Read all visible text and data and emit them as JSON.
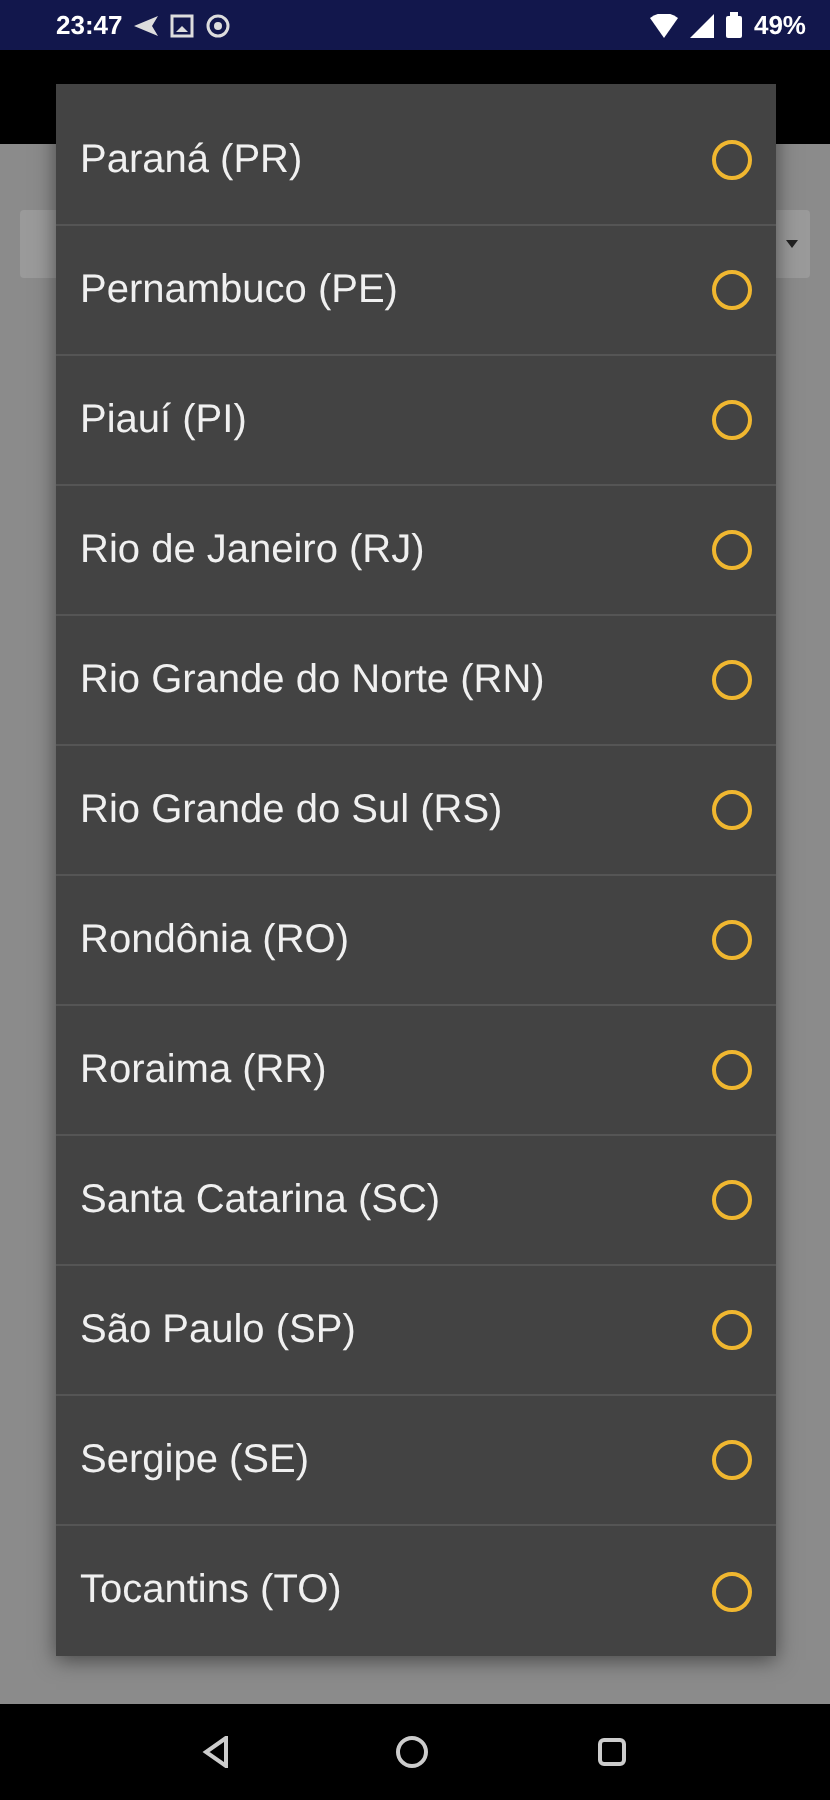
{
  "status_bar": {
    "time": "23:47",
    "battery": "49%"
  },
  "dialog": {
    "options": [
      {
        "label": "Paraná (PR)",
        "selected": false
      },
      {
        "label": "Pernambuco (PE)",
        "selected": false
      },
      {
        "label": "Piauí (PI)",
        "selected": false
      },
      {
        "label": "Rio de Janeiro (RJ)",
        "selected": false
      },
      {
        "label": "Rio Grande do Norte (RN)",
        "selected": false
      },
      {
        "label": "Rio Grande do Sul (RS)",
        "selected": false
      },
      {
        "label": "Rondônia (RO)",
        "selected": false
      },
      {
        "label": "Roraima (RR)",
        "selected": false
      },
      {
        "label": "Santa Catarina (SC)",
        "selected": false
      },
      {
        "label": "São Paulo (SP)",
        "selected": false
      },
      {
        "label": "Sergipe (SE)",
        "selected": false
      },
      {
        "label": "Tocantins (TO)",
        "selected": false
      }
    ]
  }
}
